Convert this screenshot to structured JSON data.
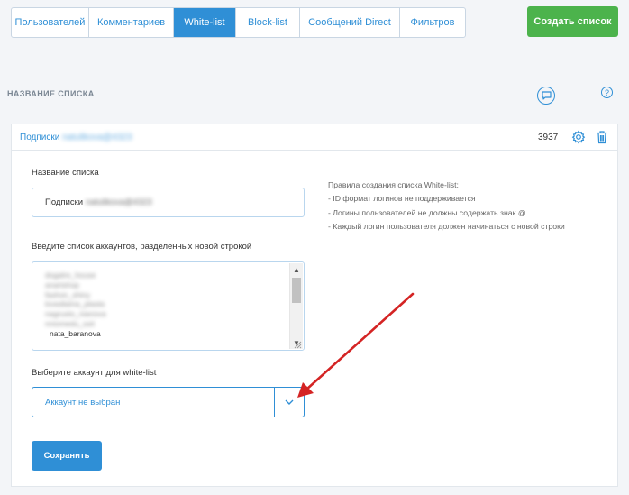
{
  "tabs": [
    {
      "label": "Пользователей",
      "active": false
    },
    {
      "label": "Комментариев",
      "active": false
    },
    {
      "label": "White-list",
      "active": true
    },
    {
      "label": "Block-list",
      "active": false
    },
    {
      "label": "Сообщений Direct",
      "active": false
    },
    {
      "label": "Фильтров",
      "active": false
    }
  ],
  "create_button": "Создать список",
  "section_title": "НАЗВАНИЕ СПИСКА",
  "help_icon": "?",
  "panel": {
    "list_name_prefix": "Подписки",
    "list_name_blurred": "natulikova@4323",
    "count": "3937"
  },
  "form": {
    "name_label": "Название списка",
    "name_value_prefix": "Подписки",
    "name_value_blurred": "natulikova@4323",
    "accounts_label": "Введите список аккаунтов, разделенных новой строкой",
    "accounts_lines_blurred": [
      "dogalre_house",
      "anartshop",
      "fashon_shiny",
      "lovediama_plasta",
      "nagrusto_nianova",
      "nniomedu_ssit"
    ],
    "accounts_last_line": "nata_baranova",
    "account_select_label": "Выберите аккаунт для white-list",
    "account_select_value": "Аккаунт не выбран",
    "save_button": "Сохранить"
  },
  "rules": {
    "title": "Правила создания списка White-list:",
    "items": [
      "- ID формат логинов не поддерживается",
      "- Логины пользователей не должны содержать знак @",
      "- Каждый логин пользователя должен начинаться с новой строки"
    ]
  },
  "colors": {
    "accent": "#2f8fd6",
    "create": "#4cb34c",
    "annotation_arrow": "#d42424"
  }
}
